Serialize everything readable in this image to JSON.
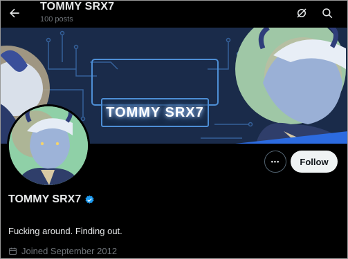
{
  "header": {
    "title": "TOMMY SRX7",
    "posts": "100 posts",
    "back_icon": "arrow-left-icon",
    "grok_icon": "grok-icon",
    "search_icon": "search-icon"
  },
  "banner": {
    "title": "TOMMY SRX7",
    "bg_color": "#1a2b4a",
    "accent_color": "#4e8fd6"
  },
  "profile": {
    "display_name": "TOMMY SRX7",
    "verified_icon": "verified-badge-icon",
    "bio": "Fucking around. Finding out.",
    "joined": "Joined September 2012"
  },
  "actions": {
    "more_label": "•••",
    "follow_label": "Follow"
  },
  "colors": {
    "background": "#000000",
    "text": "#e7e9ea",
    "muted": "#71767b",
    "verified": "#1d9bf0"
  }
}
